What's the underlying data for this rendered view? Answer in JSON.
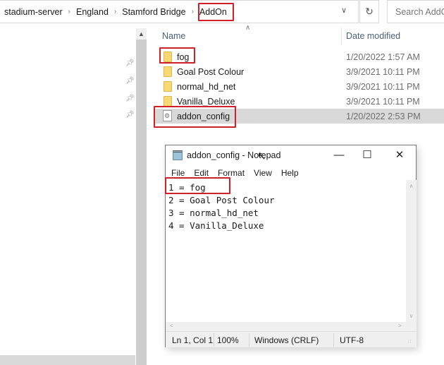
{
  "explorer": {
    "breadcrumb": [
      "stadium-server",
      "England",
      "Stamford Bridge",
      "AddOn"
    ],
    "search_placeholder": "Search AddOn",
    "columns": {
      "name": "Name",
      "date": "Date modified"
    },
    "items": [
      {
        "name": "fog",
        "type": "folder",
        "date": "1/20/2022 1:57 AM"
      },
      {
        "name": "Goal Post Colour",
        "type": "folder",
        "date": "3/9/2021 10:11 PM"
      },
      {
        "name": "normal_hd_net",
        "type": "folder",
        "date": "3/9/2021 10:11 PM"
      },
      {
        "name": "Vanilla_Deluxe",
        "type": "folder",
        "date": "3/9/2021 10:11 PM"
      },
      {
        "name": "addon_config",
        "type": "config-file",
        "date": "1/20/2022 2:53 PM",
        "selected": true
      }
    ]
  },
  "notepad": {
    "title": "addon_config - Notepad",
    "menu": [
      "File",
      "Edit",
      "Format",
      "View",
      "Help"
    ],
    "lines": [
      "1 = fog",
      "2 = Goal Post Colour",
      "3 = normal_hd_net",
      "4 = Vanilla_Deluxe"
    ],
    "status": {
      "position": "Ln 1, Col 1",
      "zoom": "100%",
      "line_ending": "Windows (CRLF)",
      "encoding": "UTF-8"
    }
  },
  "colors": {
    "highlight": "#d0202a",
    "selected_row": "#d9d9d9",
    "folder": "#f8d775"
  }
}
